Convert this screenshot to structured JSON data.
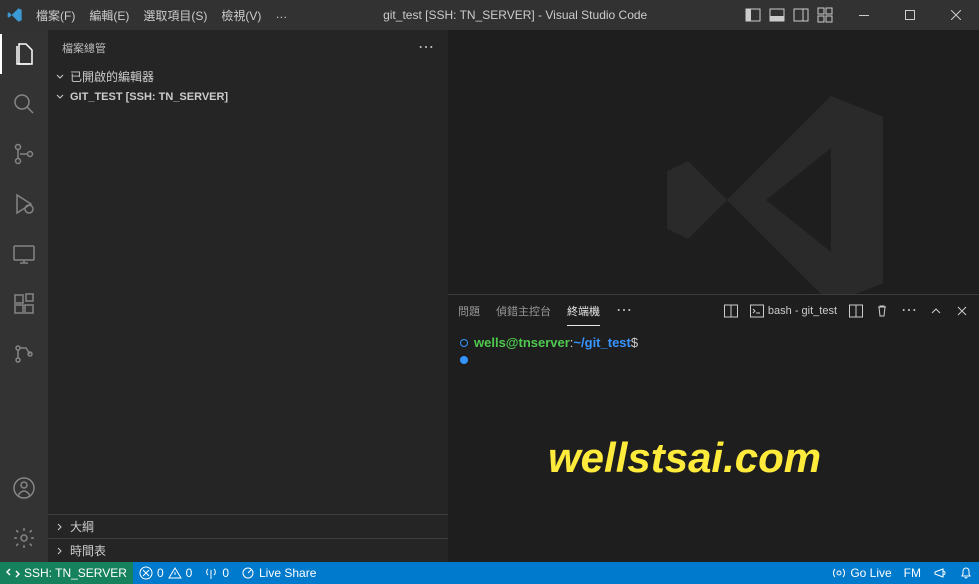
{
  "titlebar": {
    "menus": [
      "檔案(F)",
      "編輯(E)",
      "選取項目(S)",
      "檢視(V)",
      "…"
    ],
    "title": "git_test [SSH: TN_SERVER] - Visual Studio Code"
  },
  "sidebar": {
    "header": "檔案總管",
    "open_editors": "已開啟的編輯器",
    "folder": "GIT_TEST [SSH: TN_SERVER]",
    "outline": "大綱",
    "timeline": "時間表"
  },
  "panel": {
    "tabs": {
      "problems": "問題",
      "debug": "偵錯主控台",
      "terminal": "終端機"
    },
    "shell_label": "bash - git_test"
  },
  "terminal": {
    "user": "wells",
    "at": "@",
    "host": "tnserver",
    "colon": ":",
    "path": "~/git_test",
    "dollar": "$"
  },
  "statusbar": {
    "remote": "SSH: TN_SERVER",
    "errors": "0",
    "warnings": "0",
    "ports": "0",
    "liveshare": "Live Share",
    "golive": "Go Live",
    "fm": "FM"
  },
  "watermark": "wellstsai.com"
}
